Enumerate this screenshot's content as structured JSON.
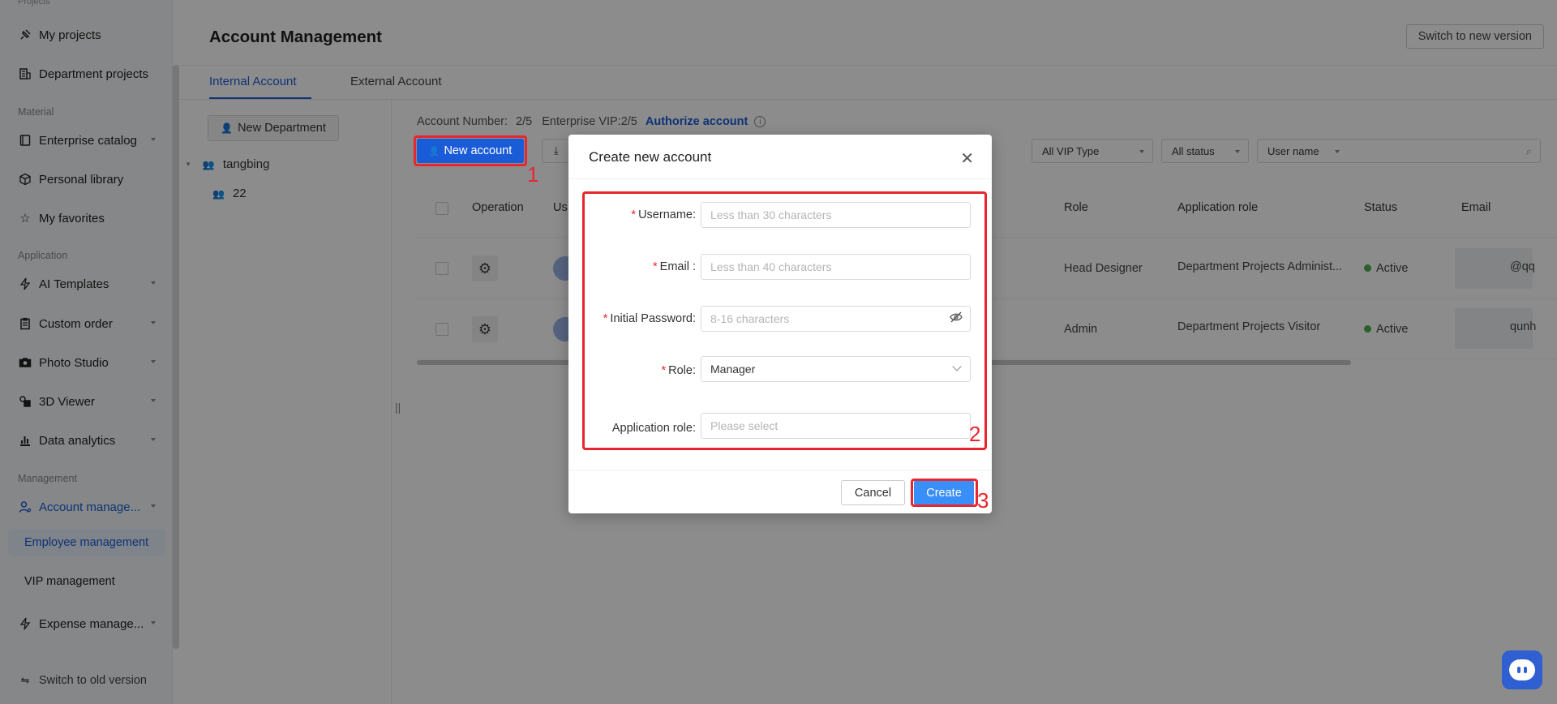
{
  "sidebar": {
    "cut_label": "Projects",
    "items": [
      {
        "label": "My projects",
        "icon": "pin-icon"
      },
      {
        "label": "Department projects",
        "icon": "building-icon"
      },
      {
        "label": "Enterprise catalog",
        "icon": "book-icon"
      },
      {
        "label": "Personal library",
        "icon": "cube-icon"
      },
      {
        "label": "My favorites",
        "icon": "star-icon"
      },
      {
        "label": "AI Templates",
        "icon": "bolt-icon"
      },
      {
        "label": "Custom order",
        "icon": "clipboard-icon"
      },
      {
        "label": "Photo Studio",
        "icon": "camera-icon"
      },
      {
        "label": "3D Viewer",
        "icon": "viewer-icon"
      },
      {
        "label": "Data analytics",
        "icon": "bar-chart-icon"
      },
      {
        "label": "Account manage...",
        "icon": "user-settings-icon"
      },
      {
        "label": "Expense manage...",
        "icon": "bolt-icon"
      }
    ],
    "sections": {
      "material": "Material",
      "application": "Application",
      "management": "Management"
    },
    "sub_items": {
      "employee": "Employee management",
      "vip": "VIP management"
    },
    "switch_old": "Switch to old version"
  },
  "header": {
    "title": "Account Management",
    "switch_new": "Switch to new version",
    "tabs": [
      "Internal Account",
      "External Account"
    ]
  },
  "tree": {
    "new_department": "New Department",
    "root": "tangbing",
    "child": "22"
  },
  "toolbar": {
    "account_number_label": "Account Number:",
    "account_number_value": "2/5",
    "enterprise_vip": "Enterprise VIP:2/5",
    "authorize": "Authorize account",
    "new_account": "New account",
    "filters": {
      "vip": "All VIP Type",
      "status": "All status",
      "field": "User name"
    }
  },
  "table": {
    "headers": {
      "operation": "Operation",
      "user": "Us",
      "role": "Role",
      "app_role": "Application role",
      "status": "Status",
      "email": "Email"
    },
    "rows": [
      {
        "role": "Head Designer",
        "app_role": "Department Projects Administ...",
        "status": "Active",
        "email_tail": "@qq"
      },
      {
        "role": "Admin",
        "app_role": "Department Projects Visitor",
        "status": "Active",
        "email_tail": "qunh"
      }
    ]
  },
  "modal": {
    "title": "Create new account",
    "fields": {
      "username": {
        "label": "Username:",
        "placeholder": "Less than 30 characters"
      },
      "email": {
        "label": "Email :",
        "placeholder": "Less than 40 characters"
      },
      "password": {
        "label": "Initial Password:",
        "placeholder": "8-16 characters"
      },
      "role": {
        "label": "Role:",
        "value": "Manager"
      },
      "app_role": {
        "label": "Application role:",
        "placeholder": "Please select"
      }
    },
    "cancel": "Cancel",
    "create": "Create"
  },
  "annotations": {
    "one": "1",
    "two": "2",
    "three": "3"
  },
  "colors": {
    "accent": "#1a5cd8",
    "annotation": "#e8262f",
    "create_button": "#3a8ef7",
    "active_dot": "#4caf50"
  }
}
